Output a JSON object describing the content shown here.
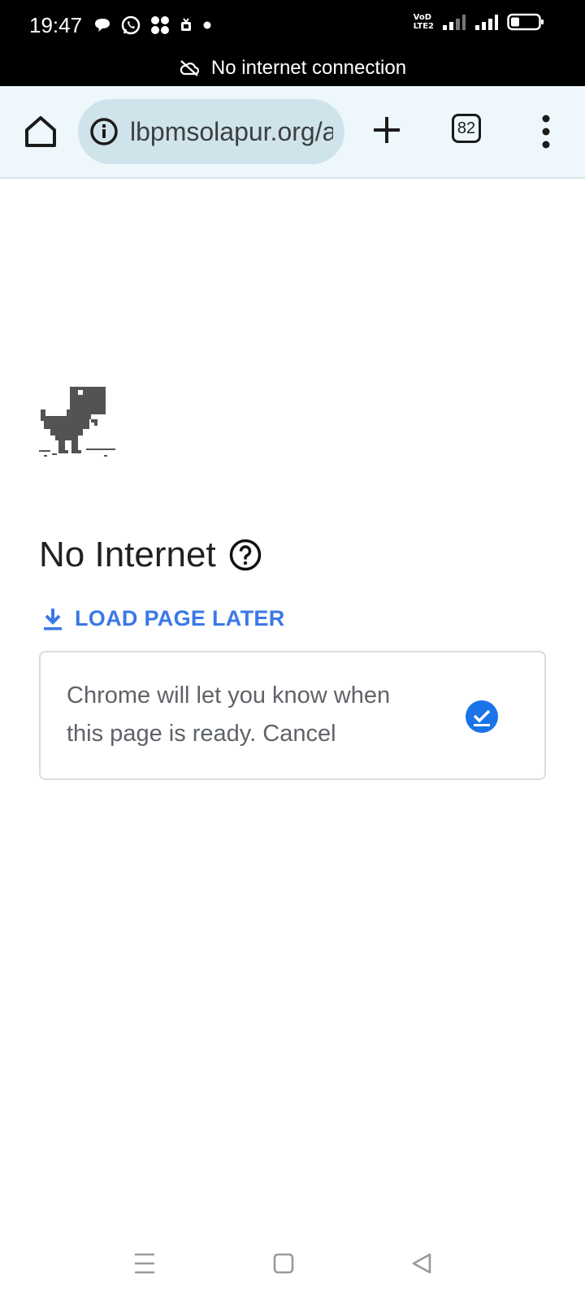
{
  "status_bar": {
    "time": "19:47",
    "left_icons": [
      "chat-bubble-icon",
      "whatsapp-icon",
      "pinwheel-icon",
      "recorder-icon",
      "dot-icon"
    ],
    "right_icons": [
      "volte-icon",
      "signal-weak-icon",
      "signal-strong-icon",
      "battery-icon"
    ],
    "network_badge_top": "VoD",
    "network_badge_bottom": "LTE2"
  },
  "offline_banner": {
    "icon": "cloud-off-icon",
    "text": "No internet connection"
  },
  "toolbar": {
    "url": "lbpmsolapur.org/a",
    "tab_count": "82"
  },
  "page": {
    "title": "No Internet",
    "load_later_label": "LOAD PAGE LATER",
    "card_message": "Chrome will let you know when this page is ready. Cancel"
  },
  "colors": {
    "accent": "#3b78e7",
    "toolbar_bg": "#eef7fb",
    "url_pill_bg": "#cfe3ea",
    "dino": "#535353"
  }
}
